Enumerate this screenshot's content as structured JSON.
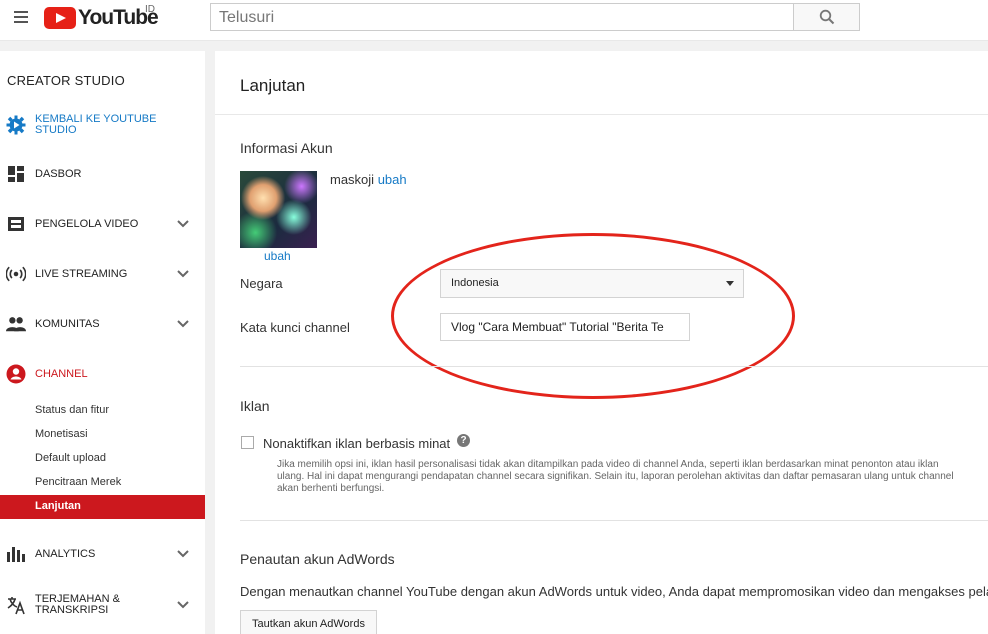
{
  "header": {
    "logo_text": "YouTube",
    "region": "ID",
    "search_placeholder": "Telusuri"
  },
  "sidebar": {
    "title": "CREATOR STUDIO",
    "items": [
      {
        "label_line1": "KEMBALI KE YOUTUBE",
        "label_line2": "STUDIO",
        "icon": "gear-icon"
      },
      {
        "label": "DASBOR",
        "icon": "dashboard-icon"
      },
      {
        "label": "PENGELOLA VIDEO",
        "icon": "video-manager-icon"
      },
      {
        "label": "LIVE STREAMING",
        "icon": "live-icon"
      },
      {
        "label": "KOMUNITAS",
        "icon": "people-icon"
      },
      {
        "label": "CHANNEL",
        "icon": "account-icon"
      },
      {
        "label": "ANALYTICS",
        "icon": "analytics-icon"
      },
      {
        "label_line1": "TERJEMAHAN &",
        "label_line2": "TRANSKRIPSI",
        "icon": "translate-icon"
      }
    ],
    "channel_sub": [
      "Status dan fitur",
      "Monetisasi",
      "Default upload",
      "Pencitraan Merek",
      "Lanjutan"
    ]
  },
  "main": {
    "title": "Lanjutan",
    "account": {
      "section_title": "Informasi Akun",
      "name": "maskoji",
      "change_link": "ubah",
      "avatar_change": "ubah",
      "country_label": "Negara",
      "country_value": "Indonesia",
      "keywords_label": "Kata kunci channel",
      "keywords_value": "Vlog \"Cara Membuat\" Tutorial \"Berita Te"
    },
    "ads": {
      "section_title": "Iklan",
      "checkbox_label": "Nonaktifkan iklan berbasis minat",
      "description_l1": "Jika memilih opsi ini, iklan hasil personalisasi tidak akan ditampilkan pada video di channel Anda, seperti iklan berdasarkan minat penonton atau iklan",
      "description_l2": "ulang. Hal ini dapat mengurangi pendapatan channel secara signifikan. Selain itu, laporan perolehan aktivitas dan daftar pemasaran ulang untuk channel",
      "description_l3": "akan berhenti berfungsi."
    },
    "adwords": {
      "section_title": "Penautan akun AdWords",
      "text": "Dengan menautkan channel YouTube dengan akun AdWords untuk video, Anda dapat mempromosikan video dan mengakses pela",
      "button": "Tautkan akun AdWords"
    }
  },
  "colors": {
    "brand_red": "#cc181e",
    "link_blue": "#167ac6",
    "annotation_red": "#e3241b"
  }
}
